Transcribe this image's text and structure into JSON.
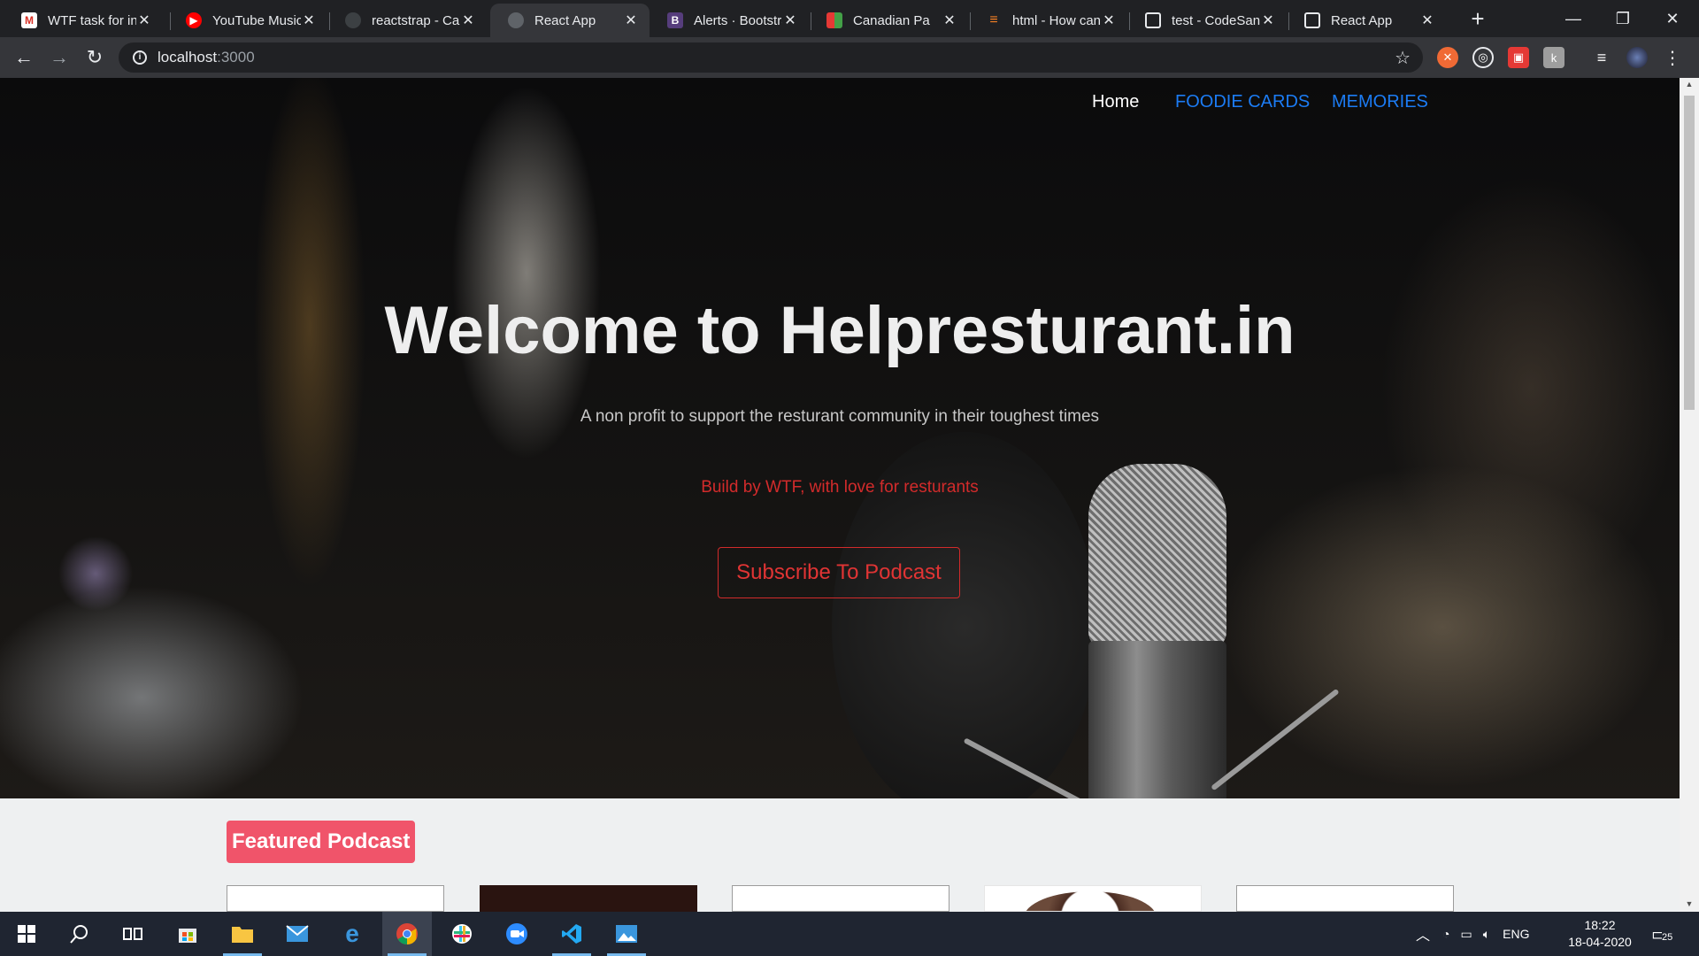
{
  "browser": {
    "tabs": [
      {
        "title": "WTF task for in",
        "icon": "gmail-icon",
        "color": "#d93025"
      },
      {
        "title": "YouTube Music",
        "icon": "youtube-music-icon",
        "color": "#ff0000"
      },
      {
        "title": "reactstrap - Car",
        "icon": "github-icon",
        "color": "#3c4043"
      },
      {
        "title": "React App",
        "icon": "react-icon",
        "color": "#5f6368"
      },
      {
        "title": "Alerts · Bootstra",
        "icon": "bootstrap-icon",
        "color": "#563d7c"
      },
      {
        "title": "Canadian Pa",
        "icon": "ca-icon",
        "color": "#ff9800"
      },
      {
        "title": "html - How can",
        "icon": "stackoverflow-icon",
        "color": "#f48024"
      },
      {
        "title": "test - CodeSan",
        "icon": "codesandbox-icon",
        "color": "#e8eaed"
      },
      {
        "title": "React App",
        "icon": "codesandbox-icon",
        "color": "#e8eaed"
      }
    ],
    "active_tab_index": 3,
    "url_host": "localhost",
    "url_port": ":3000"
  },
  "page": {
    "nav": {
      "home": "Home",
      "foodie_cards": "FOODIE CARDS",
      "memories": "MEMORIES"
    },
    "hero": {
      "title": "Welcome to Helpresturant.in",
      "subtitle": "A non profit to support the resturant community in their toughest times",
      "credit": "Build by WTF, with love for resturants",
      "button": "Subscribe To Podcast"
    },
    "featured_label": "Featured Podcast"
  },
  "taskbar": {
    "language": "ENG",
    "time": "18:22",
    "date": "18-04-2020",
    "notifications": "25"
  },
  "colors": {
    "accent_red": "#d22b2b",
    "link_blue": "#1c7cf4",
    "featured_badge": "#f0546a"
  }
}
